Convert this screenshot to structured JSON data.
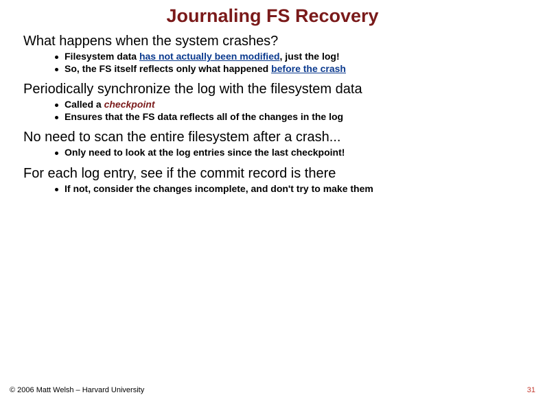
{
  "slide": {
    "title": "Journaling FS Recovery",
    "sections": [
      {
        "heading": "What happens when the system crashes?",
        "bullets": [
          {
            "pre": "Filesystem data ",
            "frag": "has not actually been modified",
            "cls": "u",
            "post": ", just the log!"
          },
          {
            "pre": "So, the FS itself reflects only what happened ",
            "frag": "before the crash",
            "cls": "u",
            "post": ""
          }
        ]
      },
      {
        "heading": "Periodically synchronize the log with the filesystem data",
        "bullets": [
          {
            "pre": "Called a ",
            "frag": "checkpoint",
            "cls": "em",
            "post": ""
          },
          {
            "pre": "Ensures that the FS data reflects all of the changes in the log",
            "frag": "",
            "cls": "",
            "post": ""
          }
        ]
      },
      {
        "heading": "No need to scan the entire filesystem after a crash...",
        "bullets": [
          {
            "pre": "Only need to look at the log entries since the last checkpoint!",
            "frag": "",
            "cls": "",
            "post": ""
          }
        ]
      },
      {
        "heading": "For each log entry, see if the commit record is there",
        "bullets": [
          {
            "pre": "If not, consider the changes incomplete, and don't try to make them",
            "frag": "",
            "cls": "",
            "post": ""
          }
        ]
      }
    ],
    "footer": {
      "left": "© 2006 Matt Welsh – Harvard University",
      "right": "31"
    }
  }
}
